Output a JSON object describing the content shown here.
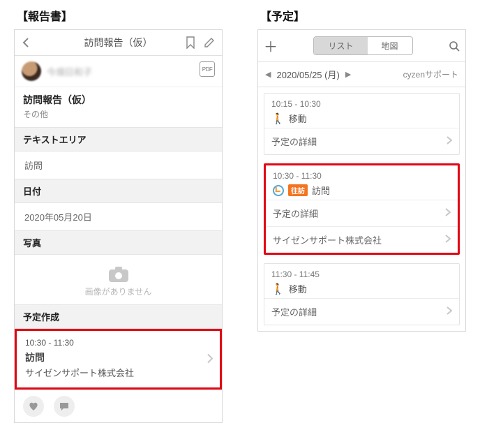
{
  "left": {
    "heading": "【報告書】",
    "header": {
      "title": "訪問報告（仮）"
    },
    "user": {
      "name": "今畑日和子",
      "pdf": "PDF"
    },
    "title": {
      "main": "訪問報告（仮）",
      "sub": "その他"
    },
    "text_area": {
      "label": "テキストエリア",
      "value": "訪問"
    },
    "date": {
      "label": "日付",
      "value": "2020年05月20日"
    },
    "photo": {
      "label": "写真",
      "empty": "画像がありません"
    },
    "schedule_create": {
      "label": "予定作成",
      "time": "10:30 - 11:30",
      "name": "訪問",
      "company": "サイゼンサポート株式会社"
    }
  },
  "right": {
    "heading": "【予定】",
    "seg": {
      "list": "リスト",
      "map": "地図"
    },
    "date_bar": {
      "date": "2020/05/25 (月)",
      "support": "cyzenサポート"
    },
    "items": [
      {
        "time": "10:15 - 10:30",
        "kind": "walk",
        "title": "移動",
        "rows": [
          {
            "label": "予定の詳細"
          }
        ],
        "highlight": false
      },
      {
        "time": "10:30 - 11:30",
        "kind": "visit",
        "tag": "往訪",
        "title": "訪問",
        "rows": [
          {
            "label": "予定の詳細"
          },
          {
            "label": "サイゼンサポート株式会社"
          }
        ],
        "highlight": true
      },
      {
        "time": "11:30 - 11:45",
        "kind": "walk",
        "title": "移動",
        "rows": [
          {
            "label": "予定の詳細"
          }
        ],
        "highlight": false
      }
    ]
  }
}
